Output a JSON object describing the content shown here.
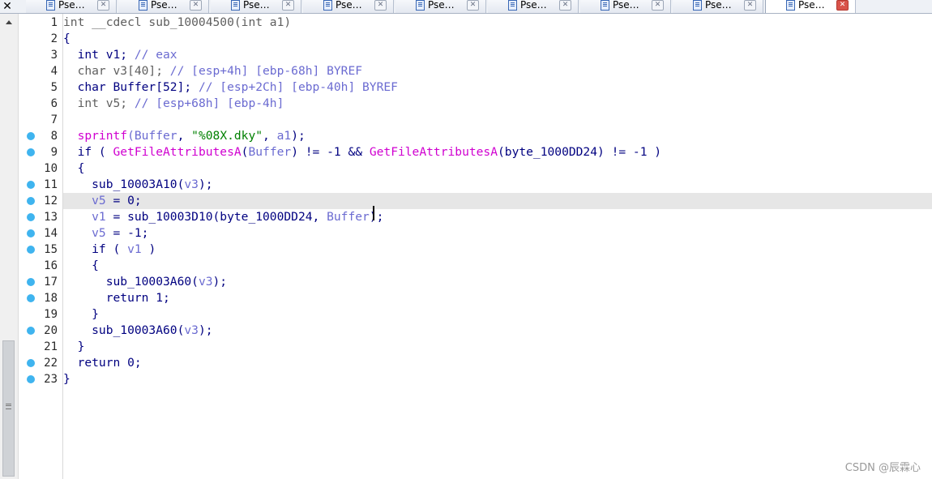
{
  "tabs": [
    {
      "label": "Pse…",
      "active": false
    },
    {
      "label": "Pse…",
      "active": false
    },
    {
      "label": "Pse…",
      "active": false
    },
    {
      "label": "Pse…",
      "active": false
    },
    {
      "label": "Pse…",
      "active": false
    },
    {
      "label": "Pse…",
      "active": false
    },
    {
      "label": "Pse…",
      "active": false
    },
    {
      "label": "Pse…",
      "active": false
    },
    {
      "label": "Pse…",
      "active": true
    }
  ],
  "tab_close_glyph": "✕",
  "colors": {
    "breakpoint": "#3fb4ef",
    "keyword": "#000080",
    "variable": "#6b6bd1",
    "api": "#d000d0",
    "string": "#008000",
    "highlight_line": "#e6e6e6"
  },
  "code_lines": [
    {
      "num": "1",
      "dot": false,
      "tokens": [
        [
          "gray",
          "int __cdecl sub_10004500(int a1)"
        ]
      ]
    },
    {
      "num": "2",
      "dot": false,
      "tokens": [
        [
          "blue",
          "{"
        ]
      ]
    },
    {
      "num": "3",
      "dot": false,
      "tokens": [
        [
          "blue",
          "  int v1; "
        ],
        [
          "var",
          "// eax"
        ]
      ]
    },
    {
      "num": "4",
      "dot": false,
      "tokens": [
        [
          "gray",
          "  char v3[40]; "
        ],
        [
          "var",
          "// [esp+4h] [ebp-68h] BYREF"
        ]
      ]
    },
    {
      "num": "5",
      "dot": false,
      "tokens": [
        [
          "blue",
          "  char Buffer[52]; "
        ],
        [
          "var",
          "// [esp+2Ch] [ebp-40h] BYREF"
        ]
      ]
    },
    {
      "num": "6",
      "dot": false,
      "tokens": [
        [
          "gray",
          "  int v5; "
        ],
        [
          "var",
          "// [esp+68h] [ebp-4h]"
        ]
      ]
    },
    {
      "num": "7",
      "dot": false,
      "tokens": []
    },
    {
      "num": "8",
      "dot": true,
      "tokens": [
        [
          "mag",
          "  sprintf"
        ],
        [
          "var",
          "(Buffer"
        ],
        [
          "blue",
          ", "
        ],
        [
          "grn",
          "\"%08X.dky\""
        ],
        [
          "blue",
          ", "
        ],
        [
          "var",
          "a1"
        ],
        [
          "blue",
          ");"
        ]
      ]
    },
    {
      "num": "9",
      "dot": true,
      "tokens": [
        [
          "blue",
          "  if ( "
        ],
        [
          "mag",
          "GetFileAttributesA"
        ],
        [
          "blue",
          "("
        ],
        [
          "var",
          "Buffer"
        ],
        [
          "blue",
          ") != -1 && "
        ],
        [
          "mag",
          "GetFileAttributesA"
        ],
        [
          "blue",
          "(byte_1000DD24) != -1 )"
        ]
      ]
    },
    {
      "num": "10",
      "dot": false,
      "tokens": [
        [
          "blue",
          "  {"
        ]
      ]
    },
    {
      "num": "11",
      "dot": true,
      "tokens": [
        [
          "blue",
          "    sub_10003A10("
        ],
        [
          "var",
          "v3"
        ],
        [
          "blue",
          ");"
        ]
      ]
    },
    {
      "num": "12",
      "dot": true,
      "tokens": [
        [
          "var",
          "    v5"
        ],
        [
          "blue",
          " = 0;"
        ]
      ],
      "highlight": true
    },
    {
      "num": "13",
      "dot": true,
      "tokens": [
        [
          "var",
          "    v1"
        ],
        [
          "blue",
          " = sub_10003D10(byte_1000DD24, "
        ],
        [
          "var",
          "Buffer"
        ],
        [
          "blue",
          ");"
        ]
      ]
    },
    {
      "num": "14",
      "dot": true,
      "tokens": [
        [
          "var",
          "    v5"
        ],
        [
          "blue",
          " = -1;"
        ]
      ]
    },
    {
      "num": "15",
      "dot": true,
      "tokens": [
        [
          "blue",
          "    if ( "
        ],
        [
          "var",
          "v1"
        ],
        [
          "blue",
          " )"
        ]
      ]
    },
    {
      "num": "16",
      "dot": false,
      "tokens": [
        [
          "blue",
          "    {"
        ]
      ]
    },
    {
      "num": "17",
      "dot": true,
      "tokens": [
        [
          "blue",
          "      sub_10003A60("
        ],
        [
          "var",
          "v3"
        ],
        [
          "blue",
          ");"
        ]
      ]
    },
    {
      "num": "18",
      "dot": true,
      "tokens": [
        [
          "blue",
          "      return 1;"
        ]
      ]
    },
    {
      "num": "19",
      "dot": false,
      "tokens": [
        [
          "blue",
          "    }"
        ]
      ]
    },
    {
      "num": "20",
      "dot": true,
      "tokens": [
        [
          "blue",
          "    sub_10003A60("
        ],
        [
          "var",
          "v3"
        ],
        [
          "blue",
          ");"
        ]
      ]
    },
    {
      "num": "21",
      "dot": false,
      "tokens": [
        [
          "blue",
          "  }"
        ]
      ]
    },
    {
      "num": "22",
      "dot": true,
      "tokens": [
        [
          "blue",
          "  return 0;"
        ]
      ]
    },
    {
      "num": "23",
      "dot": true,
      "tokens": [
        [
          "blue",
          "}"
        ]
      ]
    }
  ],
  "watermark": "CSDN @辰霖心"
}
